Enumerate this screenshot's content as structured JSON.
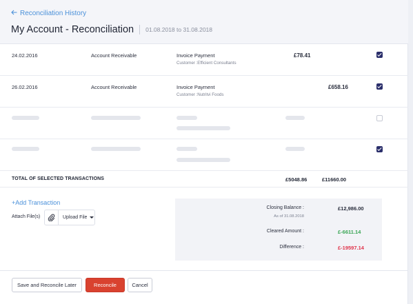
{
  "header": {
    "back_label": "Reconciliation History",
    "title": "My Account - Reconciliation",
    "date_range": "01.08.2018 to 31.08.2018"
  },
  "transactions": [
    {
      "date": "24.02.2016",
      "account": "Account Receivable",
      "description": "Invoice Payment",
      "customer": "Customer :Efficient Consultants",
      "debit": "£78.41",
      "credit": "",
      "checked": true
    },
    {
      "date": "26.02.2016",
      "account": "Account Receivable",
      "description": "Invoice Payment",
      "customer": "Customer :Nutritvi Foods",
      "debit": "",
      "credit": "£658.16",
      "checked": true
    }
  ],
  "placeholder_rows": [
    {
      "checked": false
    },
    {
      "checked": true
    }
  ],
  "totals": {
    "label": "TOTAL OF SELECTED TRANSACTIONS",
    "debit": "£5048.86",
    "credit": "£11660.00"
  },
  "actions": {
    "add_transaction": "+Add Transaction",
    "attach_label": "Attach File(s)",
    "upload_label": "Upload File"
  },
  "summary": {
    "closing_label": "Closing Balance :",
    "closing_sub": "As of 31.08.2018",
    "closing_value": "£12,986.00",
    "cleared_label": "Cleared Amount :",
    "cleared_value": "£-6611.14",
    "difference_label": "Difference :",
    "difference_value": "£-19597.14"
  },
  "footer": {
    "save_later": "Save and Reconcile Later",
    "reconcile": "Reconcile",
    "cancel": "Cancel"
  },
  "colors": {
    "accent": "#4a90d9",
    "checkbox": "#2b2f6b",
    "positive": "#3aa655",
    "negative": "#e0334a",
    "primary_button": "#d9422f"
  },
  "icons": {
    "back": "arrow-left-icon",
    "attach": "paperclip-icon",
    "dropdown": "caret-down-icon"
  }
}
